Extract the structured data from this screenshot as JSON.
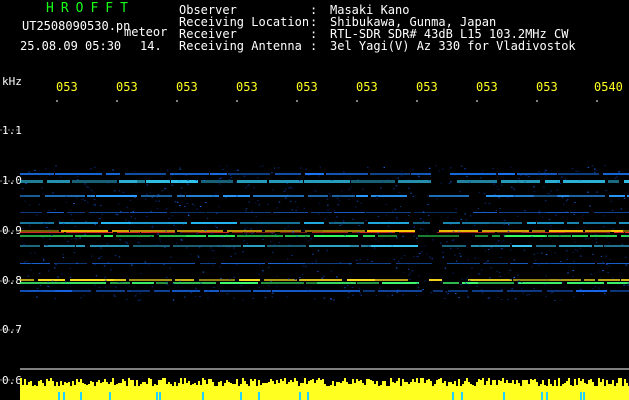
{
  "header": {
    "title": "HROFFT",
    "filename": "UT2508090530.pn",
    "capture_type": "meteor",
    "datetime": "25.08.09 05:30",
    "count": "14."
  },
  "meta": [
    {
      "label": "Observer",
      "sep": ":",
      "value": "Masaki Kano"
    },
    {
      "label": "Receiving Location",
      "sep": ":",
      "value": "Shibukawa, Gunma, Japan"
    },
    {
      "label": "Receiver",
      "sep": ":",
      "value": "RTL-SDR SDR# 43dB L15 103.2MHz CW"
    },
    {
      "label": "Receiving Antenna",
      "sep": ":",
      "value": "3el Yagi(V) Az 330 for Vladivostok"
    }
  ],
  "axis": {
    "unit": "kHz",
    "y_ticks": [
      "1.1",
      "1.0",
      "0.9",
      "0.8",
      "0.7",
      "0.6"
    ],
    "time_ticks": [
      "053",
      "053",
      "053",
      "053",
      "053",
      "053",
      "053",
      "053",
      "053",
      "0540"
    ]
  },
  "colors": {
    "header_title": "#18ff18",
    "header_info": "#ffffff",
    "time_labels": "#ffff20",
    "noise_band": "#ffff20",
    "background": "#000000"
  }
}
